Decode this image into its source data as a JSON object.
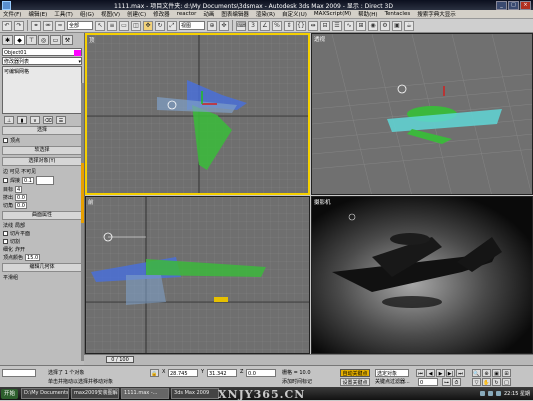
{
  "window": {
    "title": "1111.max  - 项目文件夹: d:\\My Documents\\3dsmax    - Autodesk 3ds Max  2009    - 显示 : Direct 3D"
  },
  "menu": [
    "文件(F)",
    "编辑(E)",
    "工具(T)",
    "组(G)",
    "视图(V)",
    "创建(C)",
    "修改器",
    "reactor",
    "动画",
    "图表编辑器",
    "渲染(R)",
    "自定义(U)",
    "MAXScript(M)",
    "帮助(H)",
    "Tentacles",
    "搜索字典大显示"
  ],
  "toolbar": {
    "selection_filter": "全部",
    "ref_coord": "视图",
    "snap_label": "3"
  },
  "command_panel": {
    "object_name": "Object01",
    "modifier_list": "修改器列表",
    "stack_item": "可编辑网格",
    "selection_label": "选择",
    "rollouts": [
      "软选择",
      "选择对象(Y)",
      "曲面属性",
      "编辑几何体"
    ],
    "params": {
      "label1": "顶点",
      "label2": "边 可见 不可见",
      "weld_label": "焊接",
      "weld_value": "0.1",
      "target_label": "目标",
      "target_value": "4",
      "extrude_label": "挤出",
      "extrude_value": "0.0",
      "chamfer_label": "切角",
      "chamfer_value": "0.0",
      "normal_label": "法线",
      "group": "局部",
      "slice_label": "切片平面",
      "cut_label": "切割",
      "tess_label": "细化",
      "explode_label": "炸开",
      "vertex_color_label": "顶点颜色",
      "value_15": "15.0",
      "smooth_label": "平滑组"
    }
  },
  "viewports": [
    {
      "label": "顶"
    },
    {
      "label": "透视"
    },
    {
      "label": "前"
    },
    {
      "label": "摄影机"
    }
  ],
  "timeline": {
    "frame": "0 / 100"
  },
  "status": {
    "selected": "选择了 1 个对象",
    "prompt": "单击并拖动以选择并移动对象",
    "x_value": "28.745",
    "y_value": "31.342",
    "z_value": "0.0",
    "grid": "栅格 = 10.0",
    "autokey": "自动关键点",
    "setkey": "设置关键点",
    "selection_set": "选定对象",
    "key_filters": "关键点过滤器...",
    "add_time_tag": "添加时间标记",
    "lower_field": "欢迎使用 MAXScript",
    "frame_field": "0"
  },
  "taskbar": {
    "start": "开始",
    "tasks": [
      "D:\\My Documents\\My...",
      "max2009安装图解...",
      "1111.max -...",
      "3ds Max 2009"
    ],
    "watermark": "XNJY365.CN",
    "clock": "22:15 星期"
  }
}
